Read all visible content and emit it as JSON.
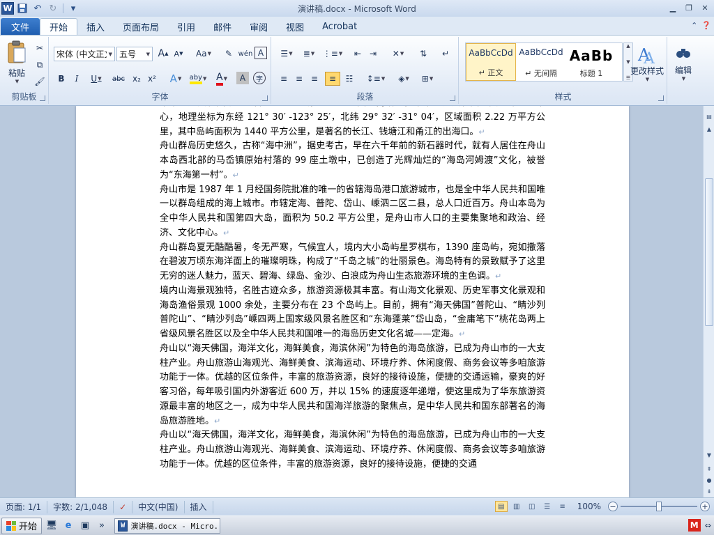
{
  "window": {
    "title": "演讲稿.docx - Microsoft Word",
    "qat_separator": "|",
    "qat_customize": "▾"
  },
  "tabs": {
    "file": "文件",
    "items": [
      "开始",
      "插入",
      "页面布局",
      "引用",
      "邮件",
      "审阅",
      "视图",
      "Acrobat"
    ],
    "active": "开始"
  },
  "ribbon": {
    "clipboard": {
      "paste_label": "粘贴",
      "group_label": "剪贴板"
    },
    "font": {
      "font_name": "宋体 (中文正文",
      "font_size": "五号",
      "grow": "A",
      "shrink": "A",
      "change_case": "Aa",
      "bold": "B",
      "italic": "I",
      "underline": "U",
      "strikethrough": "abc",
      "subscript": "x₂",
      "superscript": "x²",
      "text_effects": "A",
      "highlight": "aby",
      "font_color": "A",
      "char_shading": "A",
      "enclose": "字",
      "group_label": "字体"
    },
    "paragraph": {
      "group_label": "段落"
    },
    "styles": {
      "items": [
        {
          "preview": "AaBbCcDd",
          "name": "↵ 正文"
        },
        {
          "preview": "AaBbCcDd",
          "name": "↵ 无间隔"
        },
        {
          "preview": "AaBb",
          "name": "标题 1"
        }
      ],
      "change_styles_label": "更改样式",
      "group_label": "样式"
    },
    "editing": {
      "label": "编辑"
    }
  },
  "document": {
    "paragraphs": [
      "中华人民共和国第一大群岛——舟山，它位于我国东南沿海，中华人民共和国大陆海岸线的中心，地理坐标为东经 121° 30′ -123° 25′，北纬 29° 32′ -31° 04′，区域面积 2.22 万平方公里，其中岛屿面积为 1440 平方公里，是著名的长江、钱塘江和甬江的出海口。",
      "舟山群岛历史悠久，古称“海中洲”，据史考古，早在六千年前的新石器时代，就有人居住在舟山本岛西北部的马岙镇原始村落的 99 座土墩中，已创造了光辉灿烂的“海岛河姆渡”文化，被誉为“东海第一村”。",
      "舟山市是 1987 年 1 月经国务院批准的唯一的省辖海岛港口旅游城市，也是全中华人民共和国唯一以群岛组成的海上城市。市辖定海、普陀、岱山、嵊泗二区二县，总人口近百万。舟山本岛为全中华人民共和国第四大岛，面积为 50.2 平方公里，是舟山市人口的主要集聚地和政治、经济、文化中心。",
      "舟山群岛夏无酷酷暑，冬无严寒，气候宜人，境内大小岛屿星罗棋布，1390 座岛屿，宛如撒落在碧波万顷东海洋面上的璀璨明珠，构成了“千岛之城”的壮丽景色。海岛特有的景致赋予了这里无穷的迷人魅力，蓝天、碧海、绿岛、金沙、白浪成为舟山生态旅游环境的主色调。",
      "境内山海景观独特，名胜古迹众多，旅游资源极其丰富。有山海文化景观、历史军事文化景观和海岛渔俗景观 1000 余处，主要分布在 23 个岛屿上。目前，拥有“海天佛国”普陀山、“睛沙列普陀山”、“睛沙列岛”嵊四两上国家级风景名胜区和“东海蓬莱”岱山岛，“金庸笔下”桃花岛两上省级风景名胜区以及全中华人民共和国唯一的海岛历史文化名城——定海。",
      "舟山以“海天佛国，海洋文化，海鲜美食，海滨休闲”为特色的海岛旅游，已成为舟山市的一大支柱产业。舟山旅游山海观光、海鲜美食、滨海运动、环境疗养、休闲度假、商务会议等多咱旅游功能于一体。优越的区位条件，丰富的旅游资源，良好的接待设施，便捷的交通运输，豪爽的好客习俗，每年吸引国内外游客近 600 万，并以 15% 的速度逐年递增，使这里成为了华东旅游资源最丰富的地区之一，成为中华人民共和国海洋旅游的聚焦点，是中华人民共和国东部著名的海岛旅游胜地。",
      "舟山以“海天佛国，海洋文化，海鲜美食，海滨休闲”为特色的海岛旅游，已成为舟山市的一大支柱产业。舟山旅游山海观光、海鲜美食、滨海运动、环境疗养、休闲度假、商务会议等多咱旅游功能于一体。优越的区位条件，丰富的旅游资源，良好的接待设施，便捷的交通"
    ],
    "paragraph_mark": "↵"
  },
  "statusbar": {
    "page": "页面: 1/1",
    "words": "字数: 2/1,048",
    "language": "中文(中国)",
    "mode": "插入",
    "zoom": "100%",
    "zoom_minus": "−",
    "zoom_plus": "+"
  },
  "taskbar": {
    "start": "开始",
    "task_label": "演讲稿.docx - Micro...",
    "more": "»"
  },
  "colors": {
    "file_tab": "#2a6bc0",
    "ribbon_bg": "#e4ecf7",
    "doc_bg": "#b9c9dd",
    "active_style_bg": "#fff4c8",
    "word_brand": "#2b579a"
  }
}
